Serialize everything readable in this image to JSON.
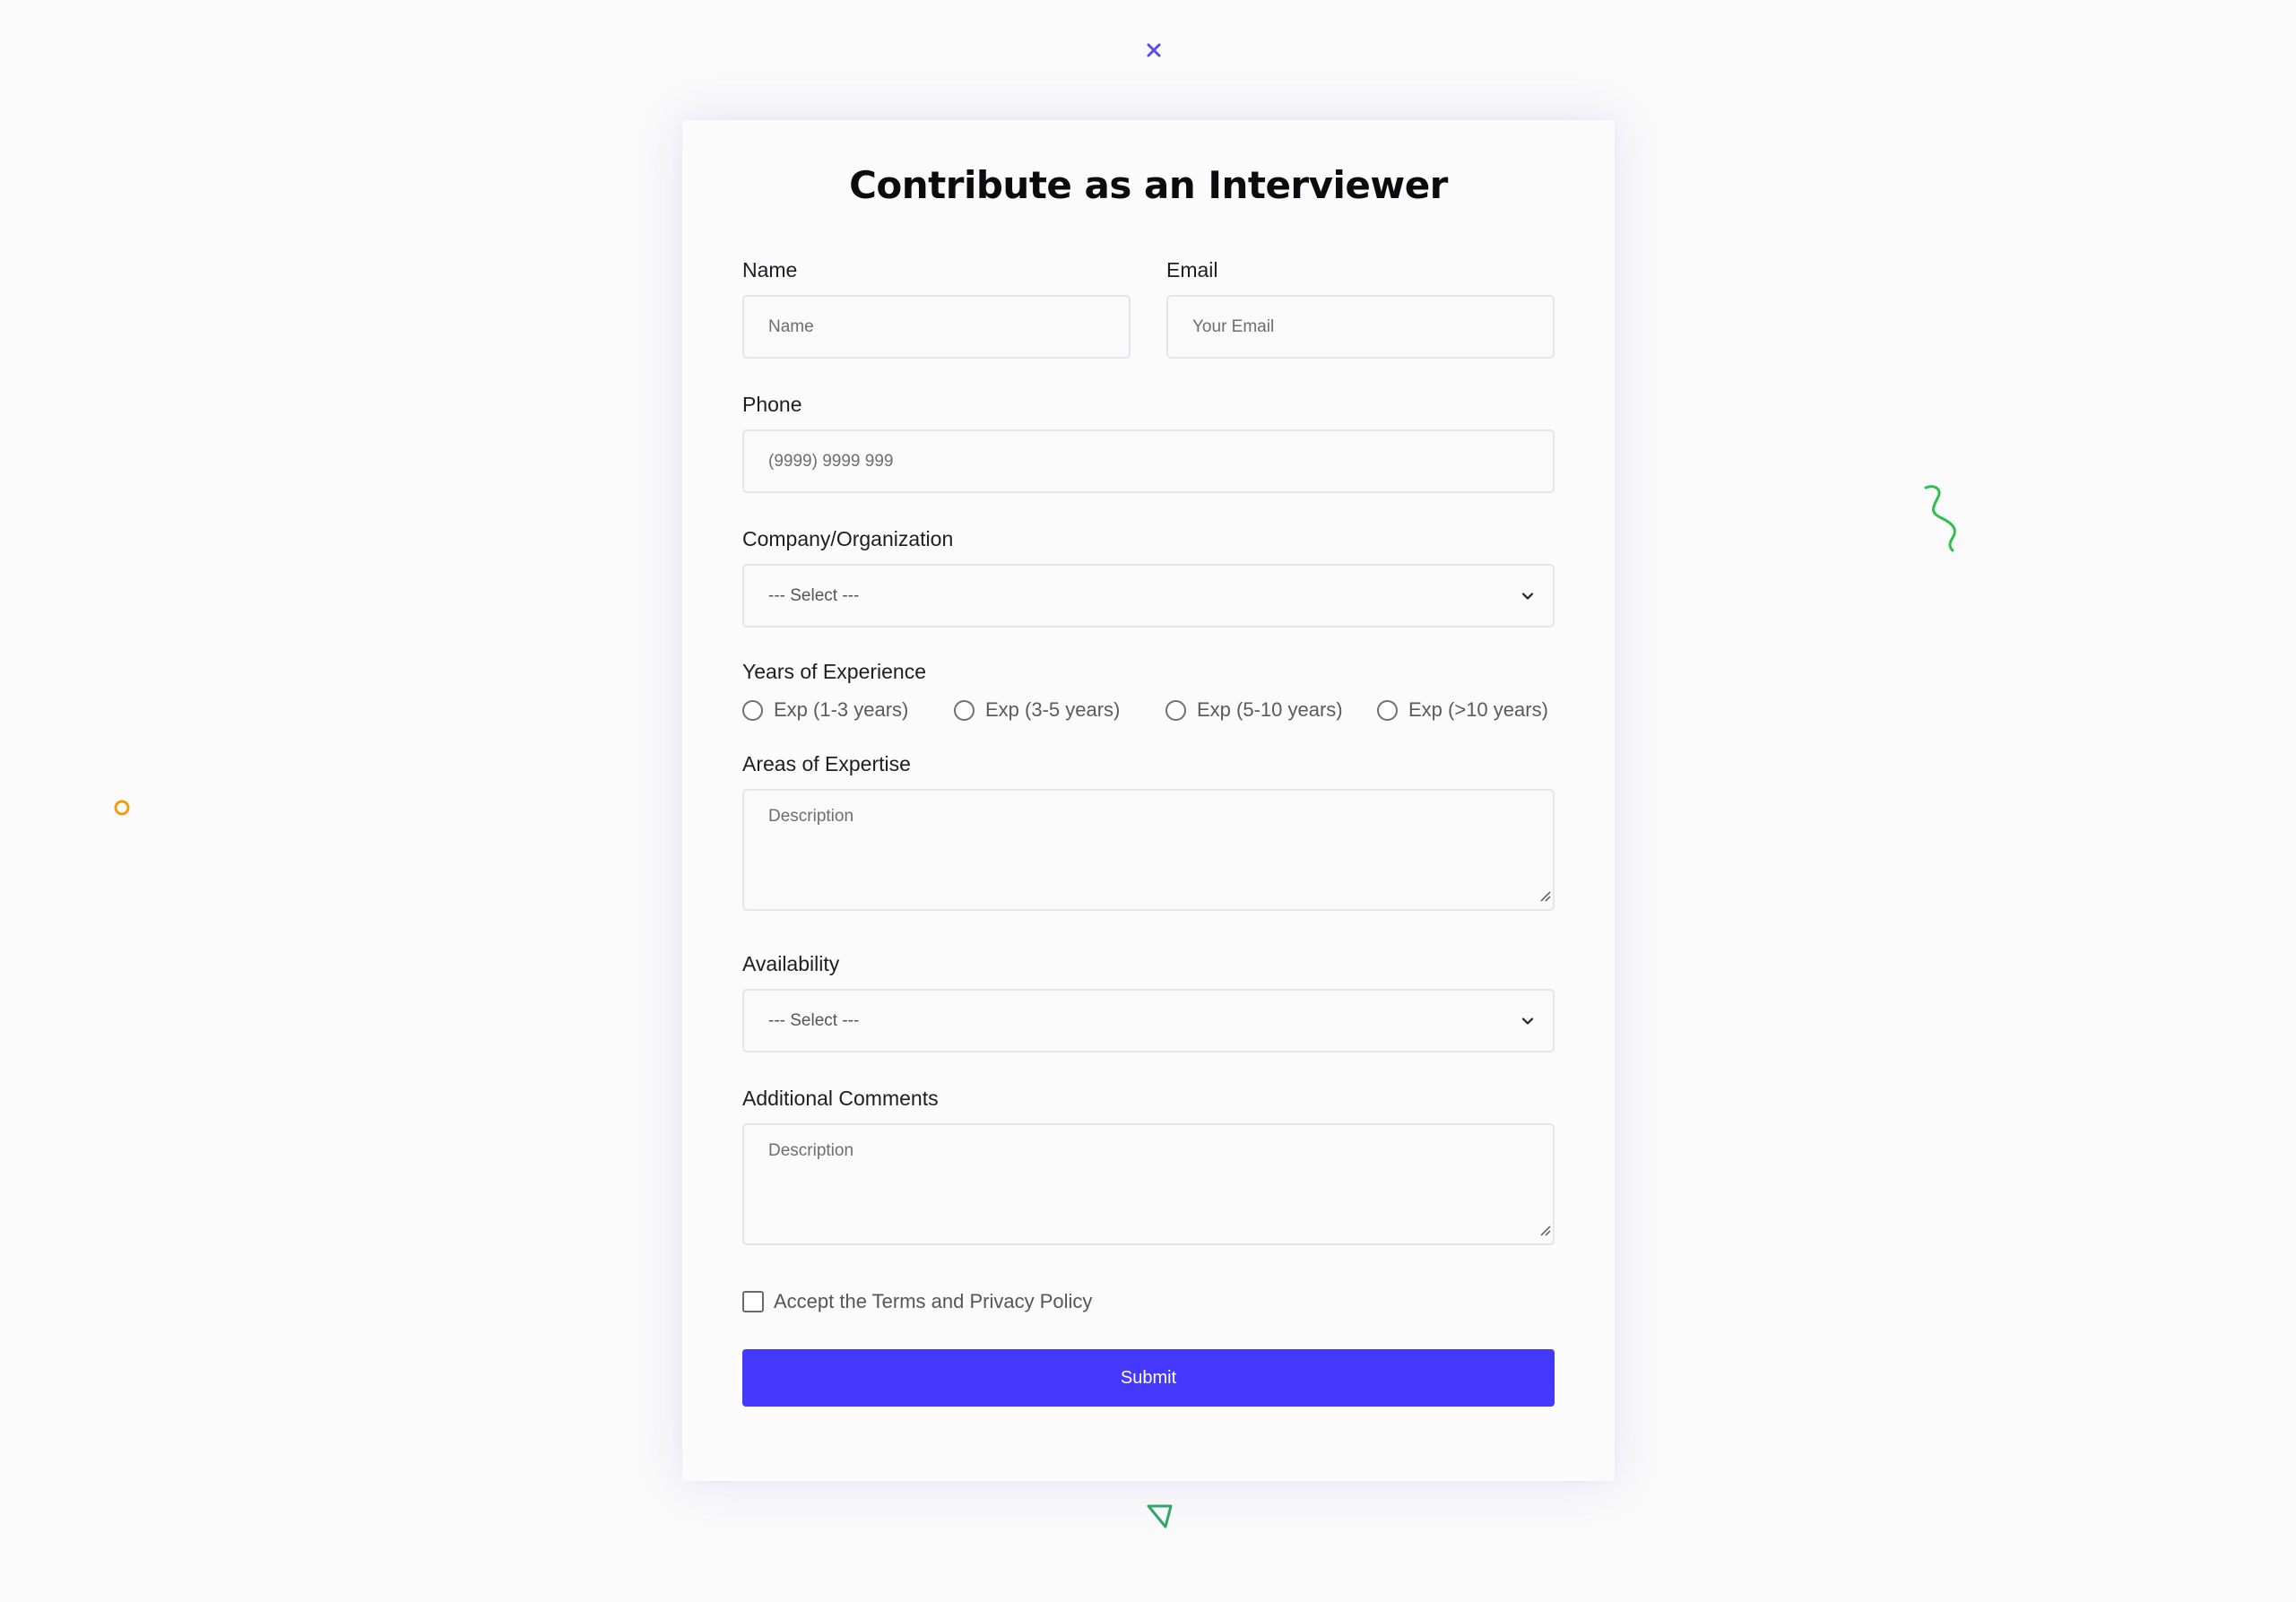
{
  "form": {
    "title": "Contribute as an Interviewer",
    "name": {
      "label": "Name",
      "placeholder": "Name"
    },
    "email": {
      "label": "Email",
      "placeholder": "Your Email"
    },
    "phone": {
      "label": "Phone",
      "placeholder": "(9999) 9999 999"
    },
    "company": {
      "label": "Company/Organization",
      "selected": "--- Select ---"
    },
    "experience": {
      "label": "Years of Experience",
      "options": [
        "Exp (1-3 years)",
        "Exp (3-5 years)",
        "Exp (5-10 years)",
        "Exp (>10 years)"
      ]
    },
    "expertise": {
      "label": "Areas of Expertise",
      "placeholder": "Description"
    },
    "availability": {
      "label": "Availability",
      "selected": "--- Select ---"
    },
    "comments": {
      "label": "Additional Comments",
      "placeholder": "Description"
    },
    "terms_label": "Accept the Terms and Privacy Policy",
    "submit_label": "Submit"
  },
  "colors": {
    "accent": "#4338fb",
    "deco_x": "#5b4de6",
    "deco_squiggle": "#2fbf4f",
    "deco_circle": "#f39c12",
    "deco_triangle": "#2fa865"
  },
  "decorations": [
    "x-icon",
    "squiggle-icon",
    "circle-icon",
    "triangle-icon"
  ]
}
